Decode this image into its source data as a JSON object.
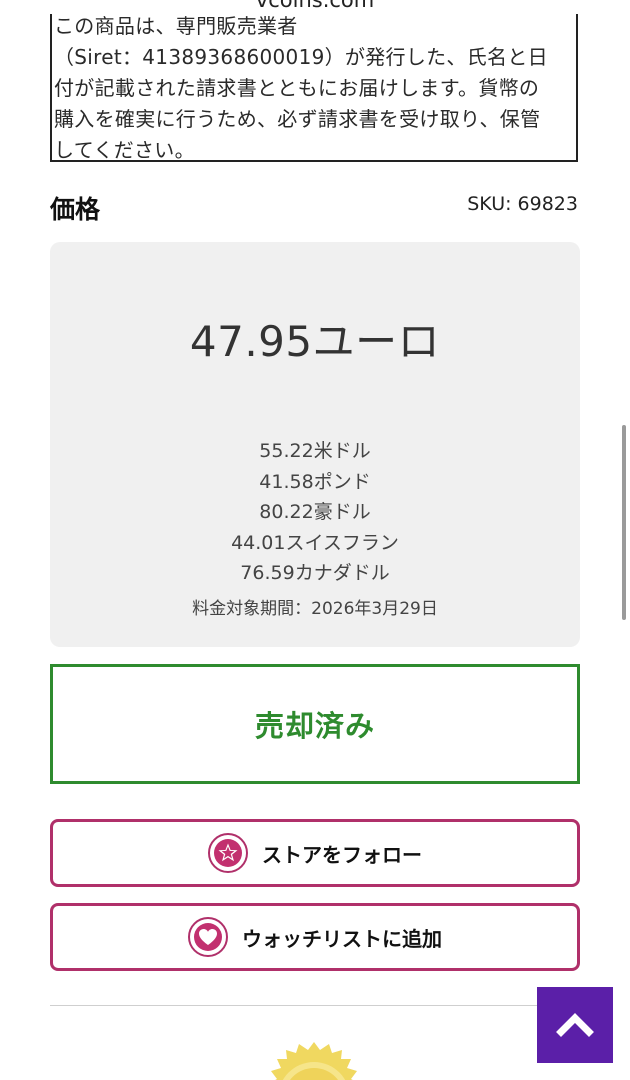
{
  "browser": {
    "url": "vcoins.com"
  },
  "notice": {
    "lines": [
      "この商品は、専門販売業者",
      "（Siret：41389368600019）が発行した、氏名と日",
      "付が記載された請求書とともにお届けします。貨幣の",
      "購入を確実に行うため、必ず請求書を受け取り、保管",
      "してください。"
    ]
  },
  "price_section": {
    "heading": "価格",
    "sku": "SKU: 69823",
    "main_price": "47.95ユーロ",
    "conversions": [
      "55.22米ドル",
      "41.58ポンド",
      "80.22豪ドル",
      "44.01スイスフラン",
      "76.59カナダドル"
    ],
    "rate_date": "料金対象期間：2026年3月29日"
  },
  "status": {
    "sold_label": "売却済み"
  },
  "actions": {
    "follow_label": "ストアをフォロー",
    "watchlist_label": "ウォッチリストに追加"
  },
  "icons": {
    "follow": "star-icon",
    "watchlist": "heart-icon",
    "scroll_top": "chevron-up-icon"
  },
  "colors": {
    "sold_green": "#2e8b2e",
    "action_magenta": "#b0306a",
    "scroll_top_purple": "#5b1fa8",
    "panel_gray": "#f0f0f0"
  }
}
